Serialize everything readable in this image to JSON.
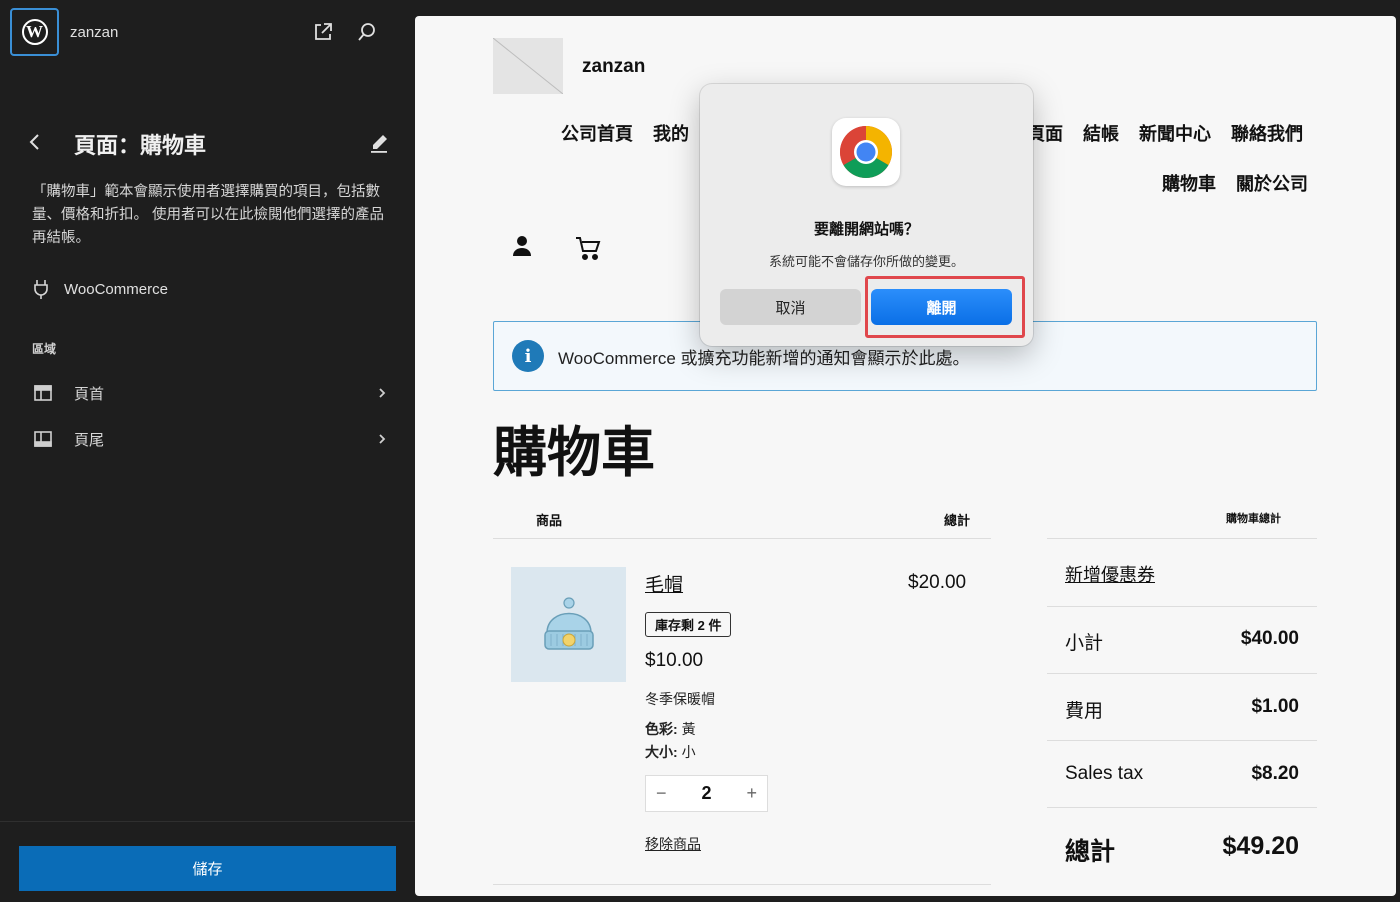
{
  "sidebar": {
    "site_name": "zanzan",
    "page_title": "頁面：購物車",
    "description": "「購物車」範本會顯示使用者選擇購買的項目，包括數量、價格和折扣。 使用者可以在此檢閱他們選擇的產品再結帳。",
    "plugin": "WooCommerce",
    "areas_label": "區域",
    "areas": [
      {
        "label": "頁首",
        "icon": "header-layout-icon"
      },
      {
        "label": "頁尾",
        "icon": "footer-layout-icon"
      }
    ],
    "save_label": "儲存"
  },
  "canvas": {
    "site_title": "zanzan",
    "nav_row1": [
      "公司首頁",
      "我的"
    ],
    "nav_row1_right": [
      "頁面",
      "結帳",
      "新聞中心",
      "聯絡我們"
    ],
    "nav_row2": [
      "購物車",
      "關於公司"
    ],
    "notice": "WooCommerce 或擴充功能新增的通知會顯示於此處。",
    "cart_title": "購物車",
    "table": {
      "col_product": "商品",
      "col_total": "總計",
      "col_cart_totals": "購物車總計"
    },
    "item": {
      "name": "毛帽",
      "line_total": "$20.00",
      "stock": "庫存剩 2 件",
      "unit_price": "$10.00",
      "description": "冬季保暖帽",
      "color_label": "色彩:",
      "color_value": "黃",
      "size_label": "大小:",
      "size_value": "小",
      "quantity": "2",
      "remove": "移除商品"
    },
    "totals": {
      "coupon": "新增優惠券",
      "subtotal_label": "小計",
      "subtotal_value": "$40.00",
      "fee_label": "費用",
      "fee_value": "$1.00",
      "tax_label": "Sales tax",
      "tax_value": "$8.20",
      "total_label": "總計",
      "total_value": "$49.20"
    }
  },
  "dialog": {
    "title": "要離開網站嗎？",
    "message": "系統可能不會儲存你所做的變更。",
    "cancel": "取消",
    "leave": "離開"
  },
  "colors": {
    "sidebar_bg": "#1e1e1e",
    "save_button": "#0a6cb7",
    "notice_border": "#5aa6d6",
    "dialog_primary": "#0a6fe6",
    "highlight": "#e0474c"
  }
}
